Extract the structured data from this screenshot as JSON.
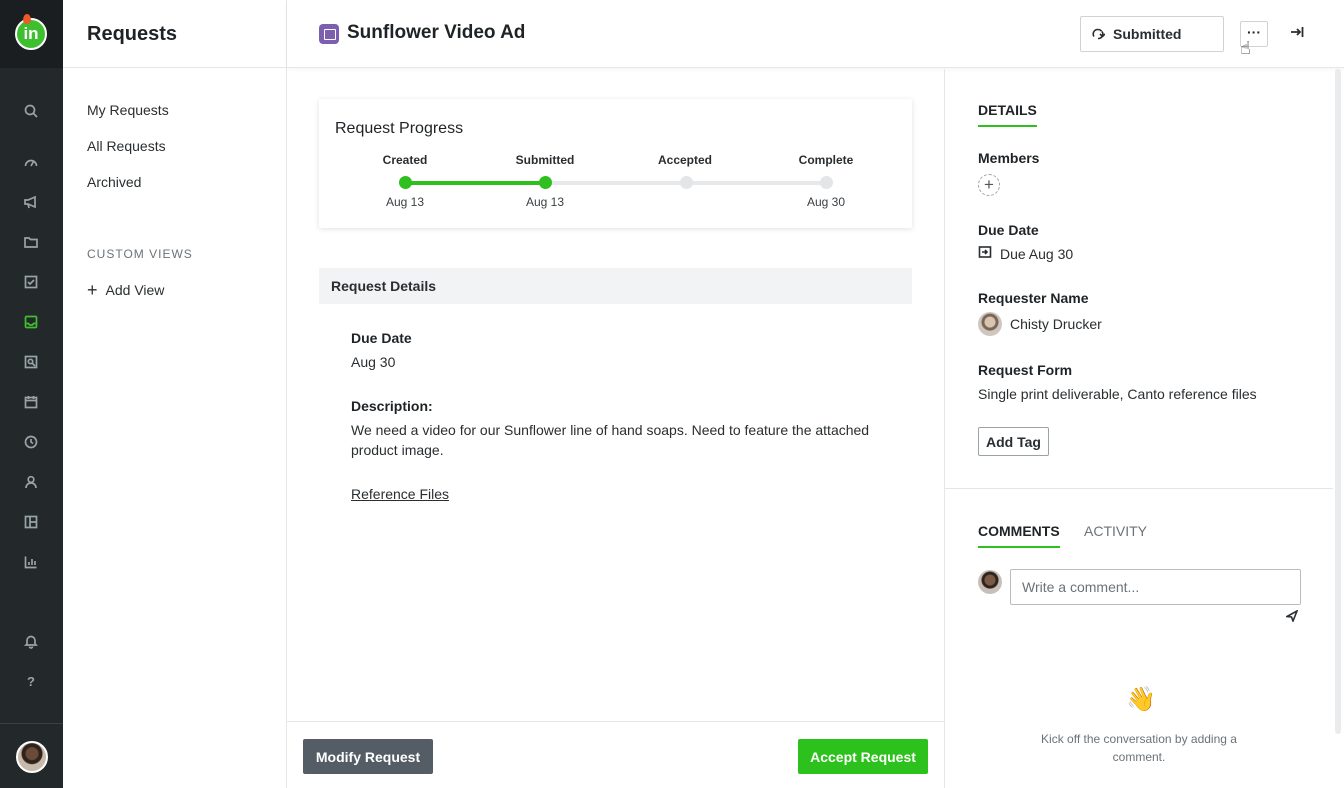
{
  "sidebar_rail": {
    "icons": [
      "search-icon",
      "dashboard-icon",
      "megaphone-icon",
      "folder-icon",
      "task-icon",
      "inbox-icon",
      "review-icon",
      "calendar-icon",
      "clock-icon",
      "user-icon",
      "layout-icon",
      "chart-icon",
      "bell-icon",
      "help-icon"
    ],
    "active": "inbox-icon",
    "help_glyph": "?",
    "logo_text": "in"
  },
  "subnav": {
    "title": "Requests",
    "items": [
      "My Requests",
      "All Requests",
      "Archived"
    ],
    "section_label": "CUSTOM VIEWS",
    "add_view": "Add View"
  },
  "header": {
    "title": "Sunflower Video Ad",
    "status": "Submitted",
    "more_label": "···"
  },
  "progress": {
    "title": "Request Progress",
    "steps": [
      {
        "label": "Created",
        "date": "Aug 13",
        "done": true
      },
      {
        "label": "Submitted",
        "date": "Aug 13",
        "done": true
      },
      {
        "label": "Accepted",
        "date": "",
        "done": false
      },
      {
        "label": "Complete",
        "date": "Aug 30",
        "done": false
      }
    ]
  },
  "details": {
    "section_title": "Request Details",
    "due_date_label": "Due Date",
    "due_date_value": "Aug 30",
    "description_label": "Description:",
    "description_value": "We need a video for our Sunflower line of hand soaps. Need to feature the attached product image.",
    "reference_link": "Reference Files"
  },
  "footer": {
    "modify": "Modify Request",
    "accept": "Accept Request"
  },
  "right_panel": {
    "details_tab": "DETAILS",
    "members_label": "Members",
    "add_member": "+",
    "due_label": "Due Date",
    "due_value": "Due Aug 30",
    "requester_label": "Requester Name",
    "requester_value": "Chisty Drucker",
    "form_label": "Request Form",
    "form_value": "Single print deliverable, Canto reference files",
    "add_tag": "Add Tag",
    "comments_tab": "COMMENTS",
    "activity_tab": "ACTIVITY",
    "comment_placeholder": "Write a comment...",
    "wave_emoji": "👋",
    "empty_text": "Kick off the conversation by adding a comment."
  },
  "colors": {
    "accent_green": "#2fbf1f",
    "rail_bg": "#23282b",
    "modify_btn": "#545d66",
    "request_icon": "#7d5fb0"
  }
}
